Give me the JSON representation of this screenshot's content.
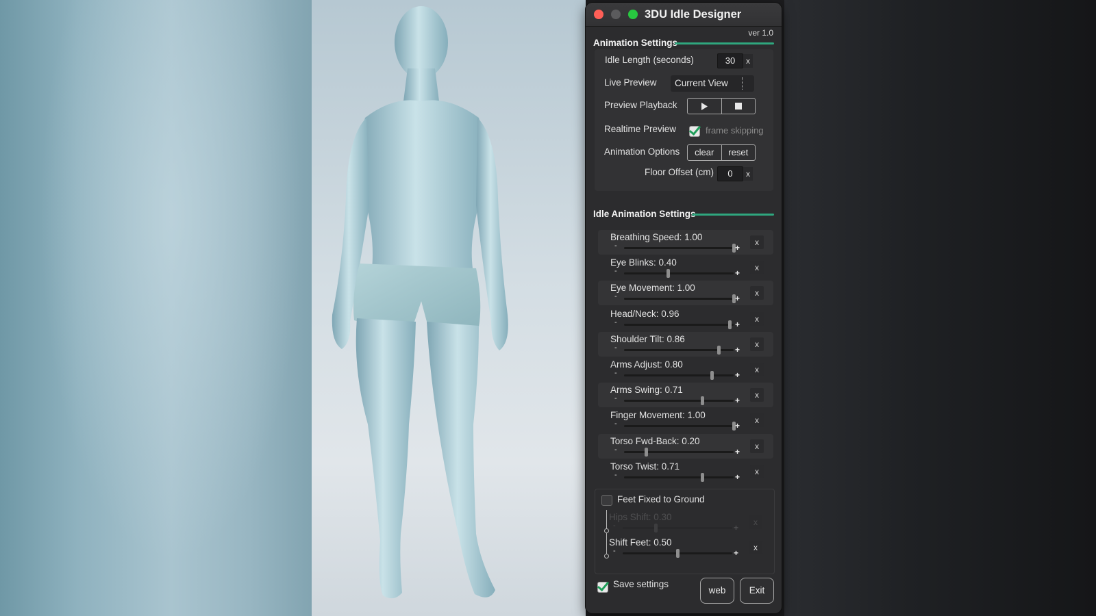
{
  "window": {
    "title": "3DU Idle Designer",
    "version": "ver 1.0"
  },
  "animation_settings": {
    "heading": "Animation Settings",
    "idle_length": {
      "label": "Idle Length (seconds)",
      "value": "30",
      "clear": "x"
    },
    "live_preview": {
      "label": "Live Preview",
      "selected": "Current View"
    },
    "preview_playback": {
      "label": "Preview Playback",
      "play_icon": "play-icon",
      "stop_icon": "stop-icon"
    },
    "realtime_preview": {
      "label": "Realtime Preview",
      "checkbox_label": "frame skipping",
      "checked": true
    },
    "animation_options": {
      "label": "Animation Options",
      "clear": "clear",
      "reset": "reset"
    },
    "floor_offset": {
      "label": "Floor Offset (cm)",
      "value": "0",
      "clear": "x"
    }
  },
  "idle_settings": {
    "heading": "Idle Animation Settings",
    "minus": "-",
    "plus": "+",
    "clear": "x",
    "sliders": [
      {
        "label": "Breathing Speed: 1.00",
        "value": 1.0
      },
      {
        "label": "Eye Blinks: 0.40",
        "value": 0.4
      },
      {
        "label": "Eye Movement: 1.00",
        "value": 1.0
      },
      {
        "label": "Head/Neck: 0.96",
        "value": 0.96
      },
      {
        "label": "Shoulder Tilt: 0.86",
        "value": 0.86
      },
      {
        "label": "Arms Adjust: 0.80",
        "value": 0.8
      },
      {
        "label": "Arms Swing: 0.71",
        "value": 0.71
      },
      {
        "label": "Finger Movement: 1.00",
        "value": 1.0
      },
      {
        "label": "Torso Fwd-Back: 0.20",
        "value": 0.2
      },
      {
        "label": "Torso Twist: 0.71",
        "value": 0.71
      }
    ],
    "feet_fixed": {
      "label": "Feet Fixed to Ground",
      "checked": false,
      "sliders": [
        {
          "label": "Hips Shift: 0.30",
          "value": 0.3,
          "disabled": true
        },
        {
          "label": "Shift Feet: 0.50",
          "value": 0.5,
          "disabled": false
        }
      ]
    }
  },
  "footer": {
    "save_settings": {
      "label": "Save settings",
      "checked": true
    },
    "web": "web",
    "exit": "Exit"
  },
  "colors": {
    "accent": "#2fa77e",
    "close": "#ff5f57",
    "maximize": "#28c840",
    "checkmark": "#1f9e5a"
  }
}
